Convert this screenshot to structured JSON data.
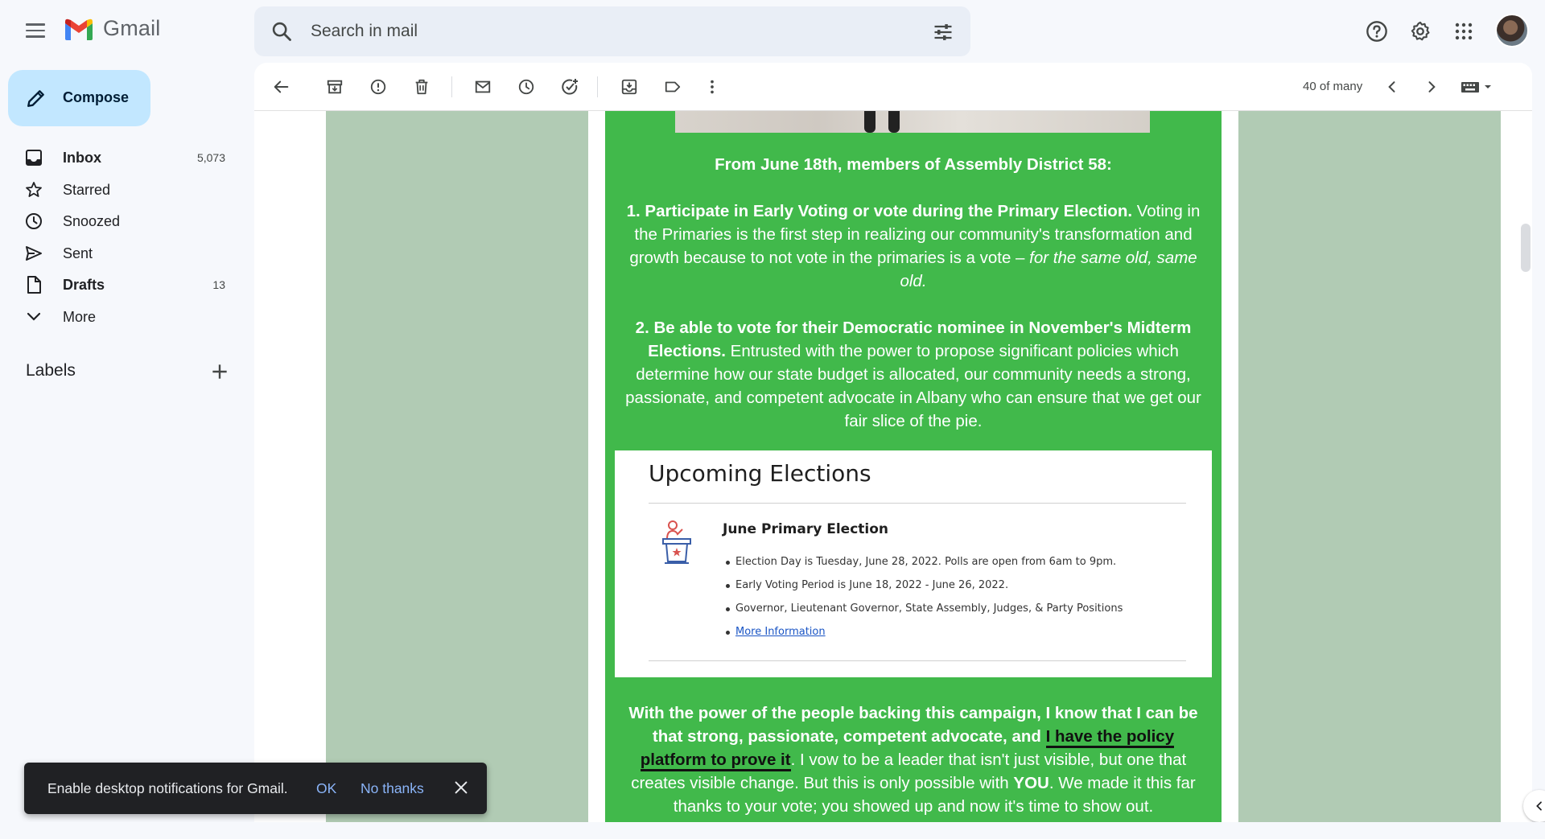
{
  "app": {
    "name": "Gmail"
  },
  "search": {
    "placeholder": "Search in mail"
  },
  "compose": {
    "label": "Compose"
  },
  "nav": [
    {
      "label": "Inbox",
      "count": "5,073",
      "bold": true
    },
    {
      "label": "Starred",
      "count": ""
    },
    {
      "label": "Snoozed",
      "count": ""
    },
    {
      "label": "Sent",
      "count": ""
    },
    {
      "label": "Drafts",
      "count": "13",
      "bold": true
    },
    {
      "label": "More",
      "count": ""
    }
  ],
  "labels": {
    "title": "Labels"
  },
  "toolbar": {
    "pager": "40 of many"
  },
  "email": {
    "heading": "From June 18th, members of Assembly District 58:",
    "p1_bold": "1.  Participate in Early Voting or vote during the Primary Election.",
    "p1_rest": " Voting in the Primaries is the first step in realizing our community's transformation and growth because to not vote in the primaries is a vote – ",
    "p1_italic": "for the same old, same old.",
    "p2_bold": "2.  Be able to vote for their Democratic nominee in November's Midterm Elections.",
    "p2_rest": " Entrusted with the power to propose significant policies which determine how our state budget is allocated, our community needs a strong, passionate, and competent advocate in Albany who can ensure that we get our fair slice of the pie.",
    "elections": {
      "title": "Upcoming Elections",
      "subtitle": "June Primary Election",
      "items": [
        "Election Day is Tuesday, June 28, 2022. Polls are open from 6am to 9pm.",
        "Early Voting Period is June 18, 2022 - June 26, 2022.",
        "Governor, Lieutenant Governor, State Assembly, Judges, & Party Positions"
      ],
      "link": "More Information"
    },
    "p3_a": "With the power of the people backing this campaign, I know that I can be that strong, passionate, competent advocate, and ",
    "p3_highlight": "I have the policy platform to prove it",
    "p3_b": ". I vow to be a leader that isn't just visible, but one that creates visible change. But this is only possible with ",
    "p3_you": "YOU",
    "p3_c": ". We made it this far thanks to your vote; you showed up and now it's time to show out."
  },
  "toast": {
    "message": "Enable desktop notifications for Gmail.",
    "ok": "OK",
    "no_thanks": "No thanks"
  },
  "colors": {
    "green": "#41b94b",
    "side_green": "#b1cbb4",
    "compose_bg": "#c2e7ff",
    "search_bg": "#e9eef6"
  }
}
